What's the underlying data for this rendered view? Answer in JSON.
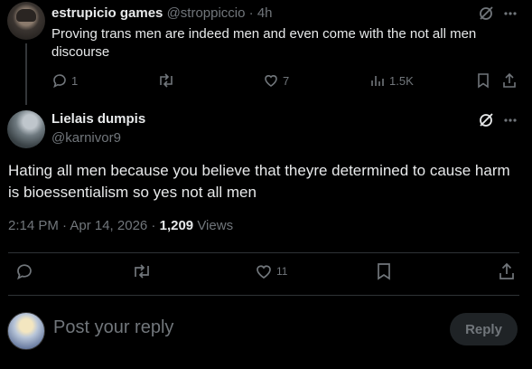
{
  "parent_tweet": {
    "display_name": "estrupicio games",
    "handle": "@stroppiccio",
    "separator": "·",
    "time_ago": "4h",
    "text": "Proving trans men are indeed men and even come with the not all men discourse",
    "replies": "1",
    "retweets": "",
    "likes": "7",
    "views": "1.5K"
  },
  "main_tweet": {
    "display_name": "Lielais dumpis",
    "handle": "@karnivor9",
    "text": "Hating all men because you believe that theyre determined to cause harm is bioessentialism so yes not all men",
    "time": "2:14 PM · Apr 14, 2026 ·",
    "views_count": "1,209",
    "views_label": "Views",
    "likes": "11"
  },
  "composer": {
    "placeholder": "Post your reply",
    "reply_button": "Reply"
  },
  "colors": {
    "background": "#000000",
    "text": "#e7e9ea",
    "muted": "#71767b",
    "divider": "#2f3336"
  }
}
